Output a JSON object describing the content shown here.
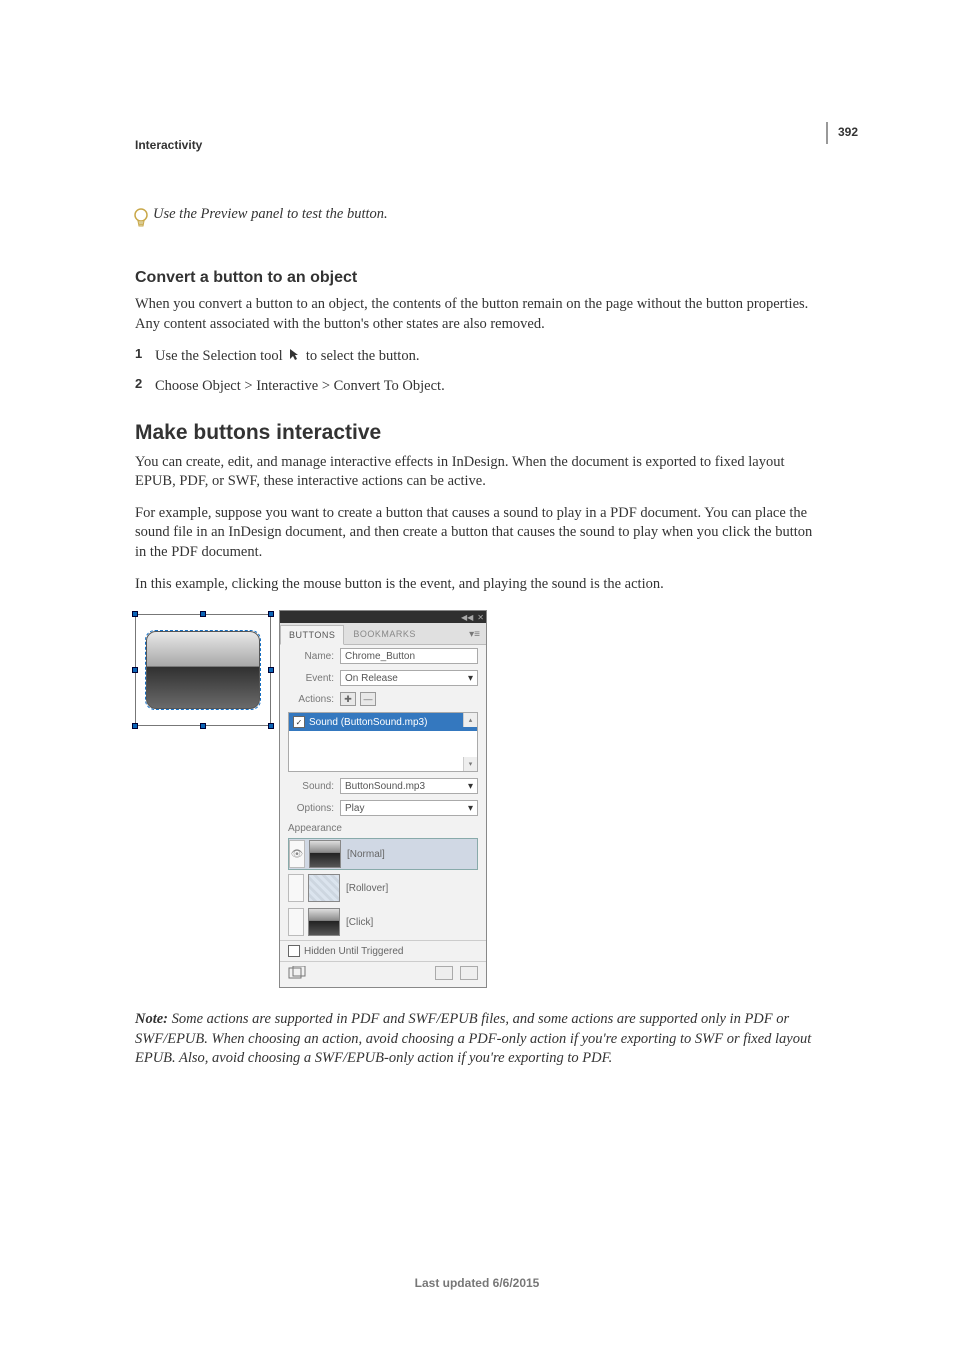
{
  "page_number": "392",
  "chapter_title": "Interactivity",
  "tip_text": "Use the Preview panel to test the button.",
  "h3_convert": "Convert a button to an object",
  "p_convert": "When you convert a button to an object, the contents of the button remain on the page without the button properties. Any content associated with the button's other states are also removed.",
  "step1_num": "1",
  "step1_a": "Use the Selection tool ",
  "step1_b": " to select the button.",
  "step2_num": "2",
  "step2": "Choose Object > Interactive > Convert To Object.",
  "h2_make": "Make buttons interactive",
  "p_make1": "You can create, edit, and manage interactive effects in InDesign. When the document is exported to fixed layout EPUB, PDF, or SWF, these interactive actions can be active.",
  "p_make2": "For example, suppose you want to create a button that causes a sound to play in a PDF document. You can place the sound file in an InDesign document, and then create a button that causes the sound to play when you click the button in the PDF document.",
  "p_make3": "In this example, clicking the mouse button is the event, and playing the sound is the action.",
  "panel": {
    "tabs": {
      "buttons": "BUTTONS",
      "bookmarks": "BOOKMARKS"
    },
    "name_label": "Name:",
    "name_value": "Chrome_Button",
    "event_label": "Event:",
    "event_value": "On Release",
    "actions_label": "Actions:",
    "action_item": "Sound (ButtonSound.mp3)",
    "sound_label": "Sound:",
    "sound_value": "ButtonSound.mp3",
    "options_label": "Options:",
    "options_value": "Play",
    "appearance_label": "Appearance",
    "state_normal": "[Normal]",
    "state_rollover": "[Rollover]",
    "state_click": "[Click]",
    "hidden_label": "Hidden Until Triggered"
  },
  "note_label": "Note: ",
  "note_text": "Some actions are supported in PDF and SWF/EPUB files, and some actions are supported only in PDF or SWF/EPUB. When choosing an action, avoid choosing a PDF-only action if you're exporting to SWF or fixed layout EPUB. Also, avoid choosing a SWF/EPUB-only action if you're exporting to PDF.",
  "footer": "Last updated 6/6/2015"
}
